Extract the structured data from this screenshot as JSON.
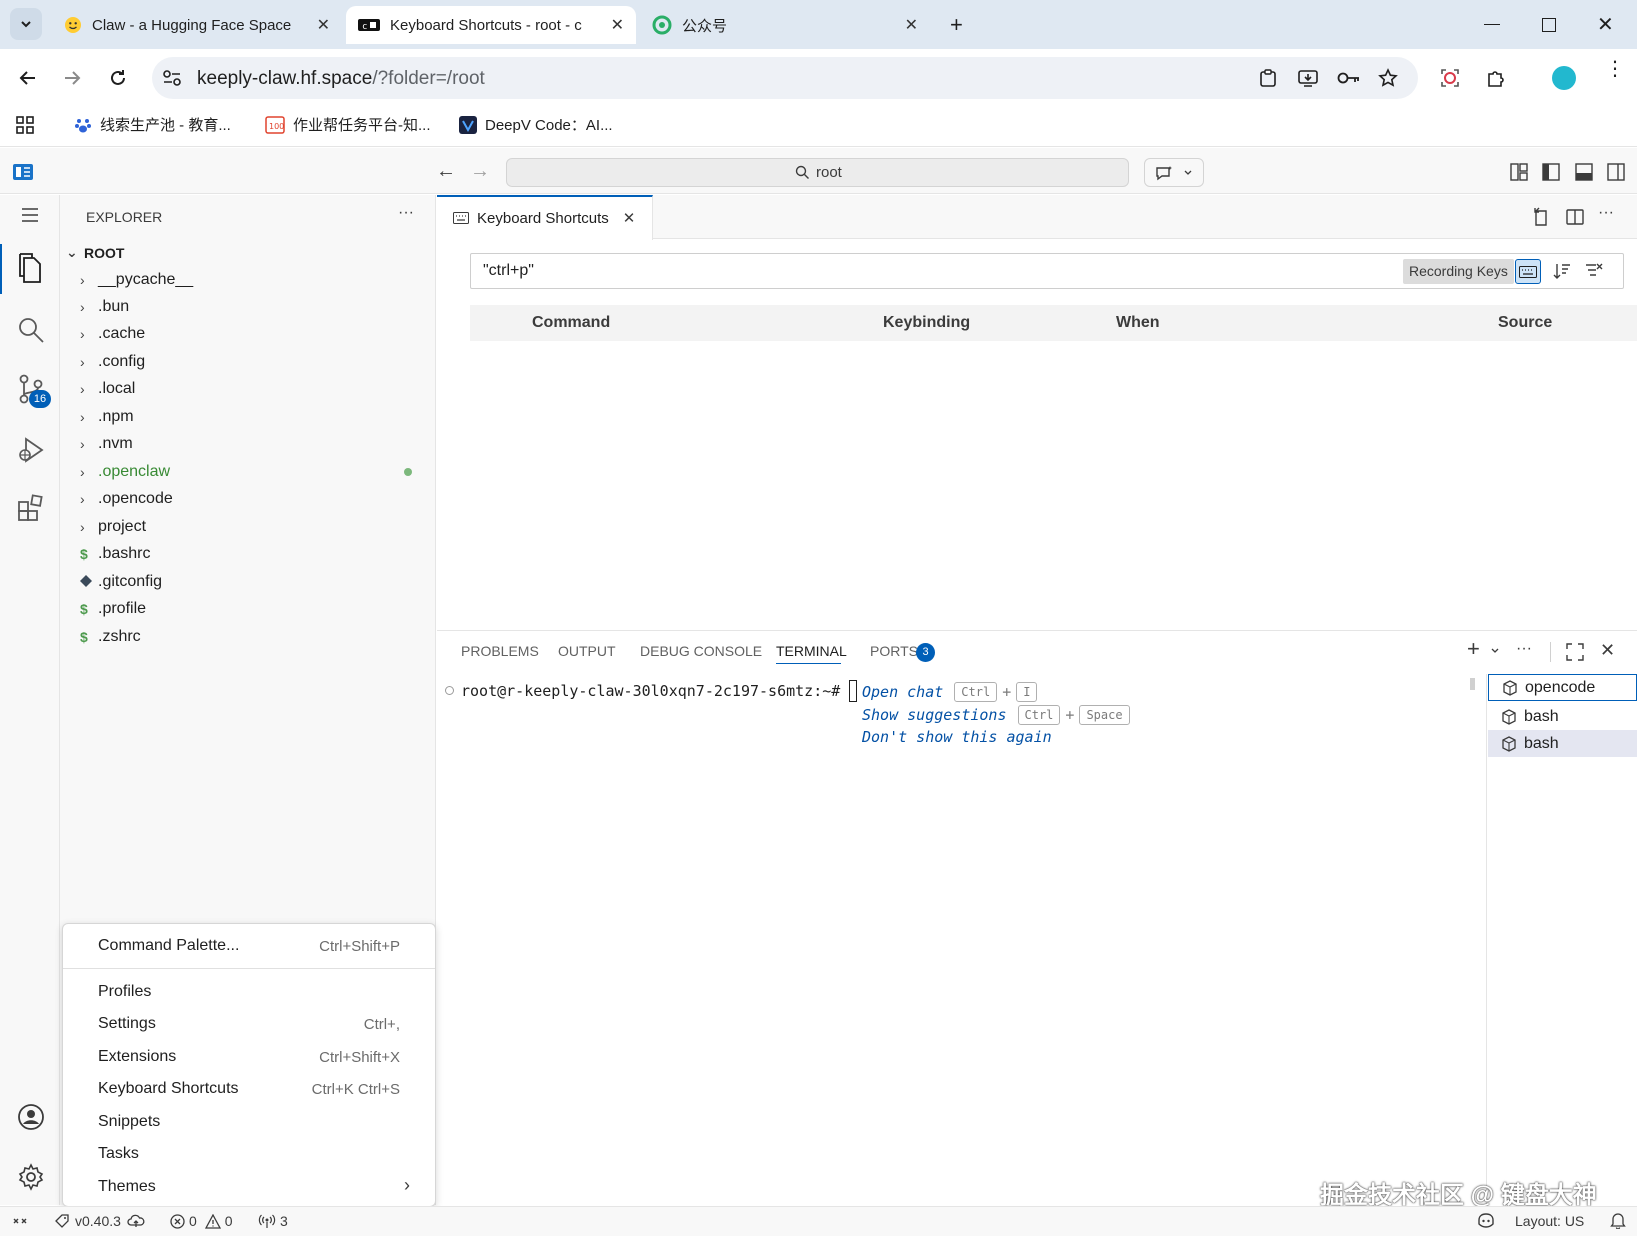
{
  "browser": {
    "tabs": [
      {
        "title": "Claw - a Hugging Face Space",
        "active": false
      },
      {
        "title": "Keyboard Shortcuts - root - c",
        "active": true
      },
      {
        "title": "公众号",
        "active": false
      }
    ],
    "url_host": "keeply-claw.hf.space",
    "url_path": "/?folder=/root",
    "bookmarks": [
      "线索生产池 - 教育...",
      "作业帮任务平台-知...",
      "DeepV Code：AI..."
    ]
  },
  "titlebar": {
    "search_text": "root"
  },
  "activity": {
    "scm_badge": "16"
  },
  "explorer": {
    "title": "EXPLORER",
    "more": "···",
    "root_label": "ROOT",
    "folders": [
      "__pycache__",
      ".bun",
      ".cache",
      ".config",
      ".local",
      ".npm",
      ".nvm",
      ".openclaw",
      ".opencode",
      "project"
    ],
    "files": [
      ".bashrc",
      ".gitconfig",
      ".profile",
      ".zshrc"
    ]
  },
  "editor": {
    "tab_title": "Keyboard Shortcuts",
    "search_value": "\"ctrl+p\"",
    "recording_label": "Recording Keys",
    "columns": [
      "Command",
      "Keybinding",
      "When",
      "Source"
    ]
  },
  "panel": {
    "tabs": [
      "PROBLEMS",
      "OUTPUT",
      "DEBUG CONSOLE",
      "TERMINAL",
      "PORTS"
    ],
    "ports_badge": "3",
    "prompt": "root@r-keeply-claw-30l0xqn7-2c197-s6mtz:~#",
    "hints": [
      {
        "text": "Open chat",
        "keys": [
          "Ctrl",
          "I"
        ]
      },
      {
        "text": "Show suggestions",
        "keys": [
          "Ctrl",
          "Space"
        ]
      },
      {
        "text": "Don't show this again",
        "keys": []
      }
    ],
    "plus": "+",
    "terminals": [
      "opencode",
      "bash",
      "bash"
    ]
  },
  "menu": {
    "items": [
      {
        "label": "Command Palette...",
        "shortcut": "Ctrl+Shift+P"
      },
      {
        "label": "Profiles",
        "shortcut": ""
      },
      {
        "label": "Settings",
        "shortcut": "Ctrl+,"
      },
      {
        "label": "Extensions",
        "shortcut": "Ctrl+Shift+X"
      },
      {
        "label": "Keyboard Shortcuts",
        "shortcut": "Ctrl+K Ctrl+S"
      },
      {
        "label": "Snippets",
        "shortcut": ""
      },
      {
        "label": "Tasks",
        "shortcut": ""
      },
      {
        "label": "Themes",
        "shortcut": ""
      }
    ]
  },
  "status": {
    "version": "v0.40.3",
    "errors": "0",
    "warnings": "0",
    "ports": "3",
    "layout": "Layout: US"
  },
  "watermark": "掘金技术社区 @ 键盘大神",
  "colors": {
    "accent": "#005fb8",
    "modified": "#388a34",
    "terminal_blue": "#0451a5"
  }
}
